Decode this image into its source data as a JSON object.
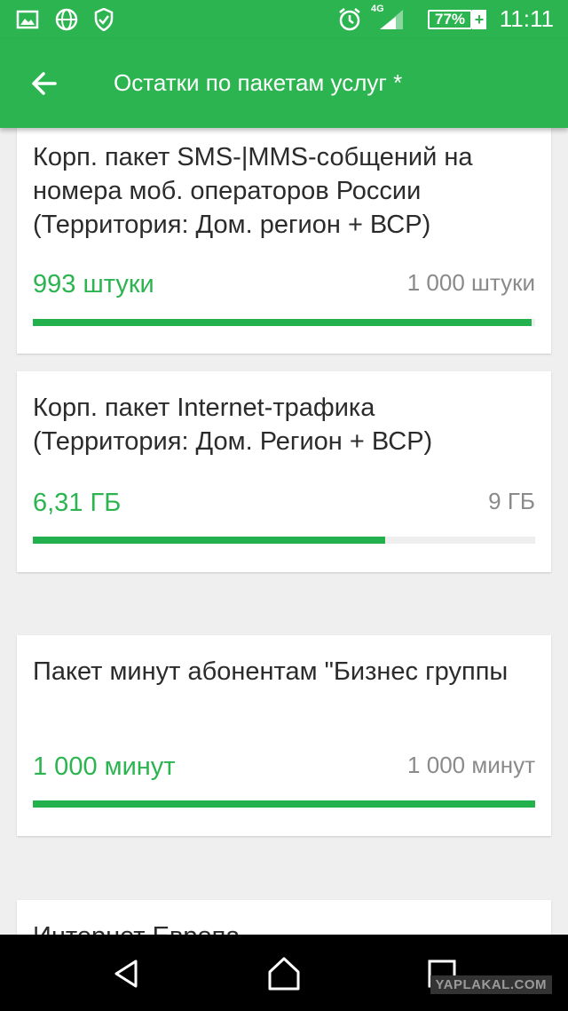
{
  "status_bar": {
    "time": "11:11",
    "network": "4G",
    "battery_percent": "77%",
    "battery_plus": "+"
  },
  "header": {
    "title": "Остатки по пакетам услуг *"
  },
  "packages": [
    {
      "name": "Корп. пакет SMS-|MMS-собщений на номера моб. операторов России (Территория: Дом. регион + ВСР)",
      "used": "993 штуки",
      "total": "1 000 штуки",
      "progress": 0.993
    },
    {
      "name": "Корп. пакет Internet-трафика (Территория: Дом. Регион + ВСР)",
      "used": "6,31 ГБ",
      "total": "9 ГБ",
      "progress": 0.701
    },
    {
      "name": "Пакет минут абонентам \"Бизнес группы",
      "used": "1 000 минут",
      "total": "1 000 минут",
      "progress": 1.0
    },
    {
      "name": "Интернет Европа"
    }
  ],
  "watermark": "YAPLAKAL.COM",
  "colors": {
    "accent": "#2cb450",
    "progress": "#22b14c",
    "background": "#efefef"
  }
}
